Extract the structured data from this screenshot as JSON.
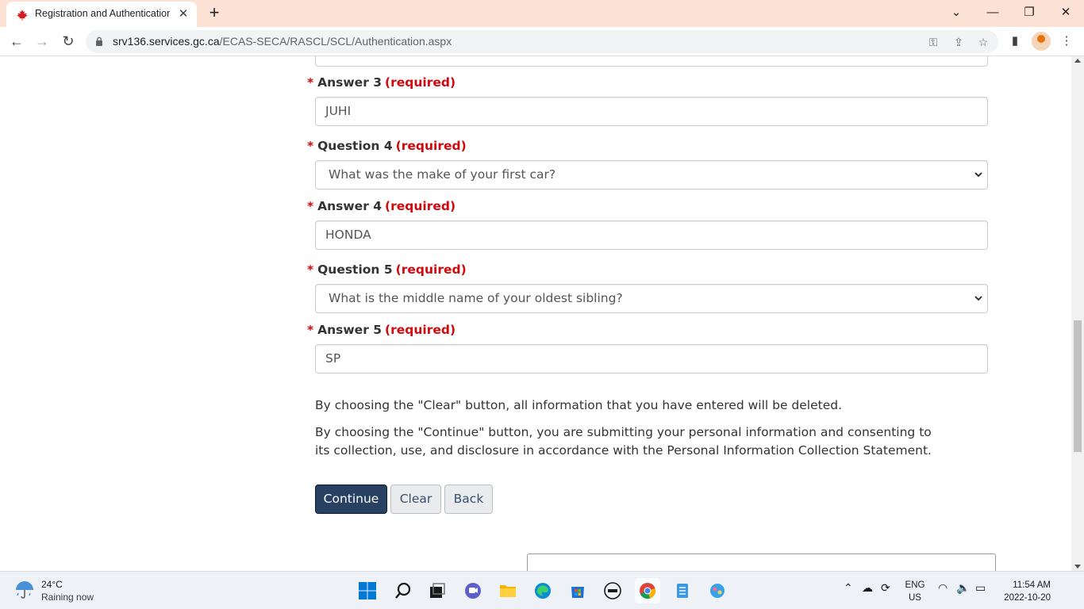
{
  "browser": {
    "tab_title": "Registration and Authentication -",
    "url_host": "srv136.services.gc.ca",
    "url_path": "/ECAS-SECA/RASCL/SCL/Authentication.aspx"
  },
  "form": {
    "required_text": "(required)",
    "answer3_label": "Answer 3",
    "answer3_value": "JUHI",
    "question4_label": "Question 4",
    "question4_value": "What was the make of your first car?",
    "answer4_label": "Answer 4",
    "answer4_value": "HONDA",
    "question5_label": "Question 5",
    "question5_value": "What is the middle name of your oldest sibling?",
    "answer5_label": "Answer 5",
    "answer5_value": "SP",
    "clear_notice": "By choosing the \"Clear\" button, all information that you have entered will be deleted.",
    "continue_notice": "By choosing the \"Continue\" button, you are submitting your personal information and consenting to its collection, use, and disclosure in accordance with the Personal Information Collection Statement.",
    "continue_label": "Continue",
    "clear_label": "Clear",
    "back_label": "Back"
  },
  "taskbar": {
    "temperature": "24°C",
    "weather": "Raining now",
    "lang_top": "ENG",
    "lang_bottom": "US",
    "time": "11:54 AM",
    "date": "2022-10-20"
  },
  "icons": {
    "tab_favicon": "maple-leaf-icon",
    "weather_icon": "rain-umbrella-icon"
  }
}
